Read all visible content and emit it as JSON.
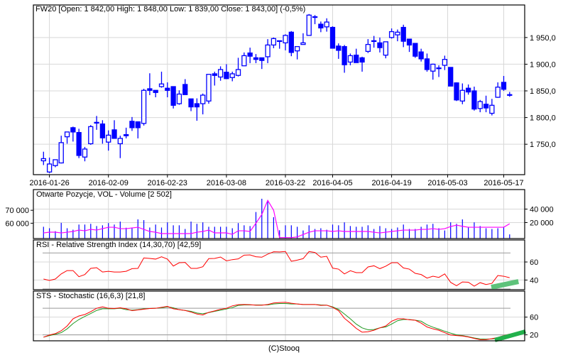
{
  "colors": {
    "candle": "#0000ff",
    "grid": "#d8d8d8",
    "ref_line": "#999999",
    "open_interest": "#ff00ff",
    "volume": "#0000ff",
    "rsi": "#ff0000",
    "sts_k": "#ff0000",
    "sts_d": "#229922",
    "band_rsi": "#5ec27a",
    "band_sts": "#22b14c"
  },
  "footer": "(C)Stooq",
  "chart_data": [
    {
      "type": "candlestick",
      "title": "FW20 [Open: 1 842,00  High: 1 848,00  Low: 1 839,00  Close: 1 843,00] (-0,5%)",
      "ylim": [
        1693,
        2011
      ],
      "y_ticks": [
        1950,
        1900,
        1850,
        1800,
        1750
      ],
      "y_tick_labels": [
        "1 950,0",
        "1 900,0",
        "1 850,0",
        "1 800,0",
        "1 750,0"
      ],
      "x_ticks": [
        {
          "label": "2016-01-26",
          "at_index": 1
        },
        {
          "label": "2016-02-09",
          "at_index": 11
        },
        {
          "label": "2016-02-23",
          "at_index": 21
        },
        {
          "label": "2016-03-08",
          "at_index": 31
        },
        {
          "label": "2016-03-22",
          "at_index": 41
        },
        {
          "label": "2016-04-05",
          "at_index": 49
        },
        {
          "label": "2016-04-19",
          "at_index": 59
        },
        {
          "label": "2016-05-03",
          "at_index": 68.5
        },
        {
          "label": "2016-05-17",
          "at_index": 78
        }
      ],
      "ohlc": [
        [
          1719,
          1736,
          1711,
          1723
        ],
        [
          1698,
          1725,
          1696,
          1713
        ],
        [
          1710,
          1721,
          1707,
          1721
        ],
        [
          1715,
          1766,
          1714,
          1753
        ],
        [
          1764,
          1773,
          1751,
          1773
        ],
        [
          1781,
          1783,
          1755,
          1773
        ],
        [
          1772,
          1779,
          1724,
          1729
        ],
        [
          1726,
          1745,
          1718,
          1741
        ],
        [
          1751,
          1786,
          1749,
          1783
        ],
        [
          1790,
          1803,
          1777,
          1791
        ],
        [
          1788,
          1795,
          1751,
          1762
        ],
        [
          1754,
          1776,
          1738,
          1767
        ],
        [
          1777,
          1795,
          1761,
          1761
        ],
        [
          1751,
          1766,
          1724,
          1761
        ],
        [
          1768,
          1781,
          1761,
          1766
        ],
        [
          1793,
          1801,
          1775,
          1781
        ],
        [
          1792,
          1793,
          1761,
          1781
        ],
        [
          1789,
          1854,
          1785,
          1851
        ],
        [
          1854,
          1883,
          1842,
          1851
        ],
        [
          1851,
          1851,
          1838,
          1847
        ],
        [
          1858,
          1886,
          1856,
          1863
        ],
        [
          1855,
          1866,
          1838,
          1851
        ],
        [
          1858,
          1858,
          1817,
          1823
        ],
        [
          1826,
          1851,
          1824,
          1844
        ],
        [
          1862,
          1872,
          1843,
          1843
        ],
        [
          1835,
          1835,
          1812,
          1820
        ],
        [
          1826,
          1836,
          1794,
          1820
        ],
        [
          1826,
          1845,
          1806,
          1842
        ],
        [
          1831,
          1881,
          1826,
          1881
        ],
        [
          1882,
          1886,
          1860,
          1879
        ],
        [
          1876,
          1896,
          1869,
          1890
        ],
        [
          1885,
          1900,
          1872,
          1873
        ],
        [
          1875,
          1886,
          1868,
          1882
        ],
        [
          1879,
          1912,
          1877,
          1890
        ],
        [
          1897,
          1922,
          1897,
          1916
        ],
        [
          1921,
          1931,
          1902,
          1915
        ],
        [
          1912,
          1919,
          1902,
          1909
        ],
        [
          1912,
          1912,
          1891,
          1907
        ],
        [
          1914,
          1947,
          1902,
          1936
        ],
        [
          1936,
          1950,
          1930,
          1948
        ],
        [
          1943,
          1944,
          1929,
          1944
        ],
        [
          1940,
          1956,
          1926,
          1954
        ],
        [
          1960,
          1962,
          1915,
          1922
        ],
        [
          1925,
          1933,
          1909,
          1933
        ],
        [
          1937,
          1958,
          1937,
          1940
        ],
        [
          1954,
          1994,
          1954,
          1992
        ],
        [
          1989,
          1992,
          1975,
          1988
        ],
        [
          1975,
          1980,
          1960,
          1968
        ],
        [
          1970,
          1986,
          1961,
          1979
        ],
        [
          1969,
          1971,
          1930,
          1930
        ],
        [
          1934,
          1939,
          1910,
          1926
        ],
        [
          1933,
          1936,
          1884,
          1899
        ],
        [
          1904,
          1920,
          1898,
          1916
        ],
        [
          1917,
          1929,
          1903,
          1903
        ],
        [
          1912,
          1914,
          1886,
          1904
        ],
        [
          1924,
          1947,
          1921,
          1937
        ],
        [
          1943,
          1953,
          1931,
          1944
        ],
        [
          1940,
          1950,
          1922,
          1931
        ],
        [
          1917,
          1942,
          1911,
          1942
        ],
        [
          1950,
          1967,
          1948,
          1961
        ],
        [
          1955,
          1965,
          1943,
          1960
        ],
        [
          1969,
          1974,
          1932,
          1943
        ],
        [
          1947,
          1947,
          1923,
          1936
        ],
        [
          1939,
          1939,
          1912,
          1915
        ],
        [
          1923,
          1929,
          1905,
          1910
        ],
        [
          1910,
          1920,
          1886,
          1890
        ],
        [
          1887,
          1901,
          1871,
          1900
        ],
        [
          1893,
          1898,
          1876,
          1893
        ],
        [
          1898,
          1916,
          1889,
          1909
        ],
        [
          1894,
          1894,
          1859,
          1859
        ],
        [
          1865,
          1866,
          1831,
          1833
        ],
        [
          1831,
          1864,
          1825,
          1851
        ],
        [
          1855,
          1862,
          1843,
          1848
        ],
        [
          1850,
          1858,
          1813,
          1816
        ],
        [
          1817,
          1833,
          1810,
          1830
        ],
        [
          1825,
          1841,
          1810,
          1818
        ],
        [
          1808,
          1835,
          1804,
          1823
        ],
        [
          1838,
          1866,
          1837,
          1857
        ],
        [
          1866,
          1878,
          1850,
          1853
        ],
        [
          1842,
          1848,
          1839,
          1843
        ]
      ]
    },
    {
      "type": "bar+line",
      "title": "Otwarte Pozycje, VOL - Volume [2 502]",
      "left_axis": {
        "name": "open interest",
        "ylim": [
          48140,
          86000
        ],
        "ticks": [
          70000,
          60000
        ],
        "tick_labels": [
          "70 000",
          "60 000"
        ]
      },
      "right_axis": {
        "name": "volume",
        "ylim": [
          -3700,
          68900
        ],
        "ticks": [
          40000,
          20000
        ],
        "tick_labels": [
          "40 000",
          "20 000"
        ]
      },
      "volume": [
        13770,
        11580,
        7210,
        19560,
        11580,
        9400,
        17050,
        17050,
        18140,
        14860,
        15950,
        19230,
        17050,
        21420,
        12350,
        12680,
        24700,
        23610,
        12680,
        17050,
        12680,
        20330,
        15950,
        15950,
        10490,
        21420,
        18140,
        20330,
        13770,
        13770,
        13770,
        13770,
        11580,
        19230,
        15950,
        14860,
        35630,
        55300,
        50930,
        27980,
        8680,
        15950,
        15950,
        13770,
        8310,
        15950,
        10490,
        11580,
        9400,
        17050,
        15950,
        20330,
        14860,
        13770,
        13770,
        15950,
        10490,
        14860,
        11580,
        10490,
        12680,
        17050,
        10490,
        10490,
        13770,
        17050,
        18140,
        11580,
        8310,
        20330,
        18140,
        24700,
        12680,
        20330,
        14860,
        11580,
        10490,
        11580,
        13770,
        2502
      ],
      "open_interest": [
        52510,
        53060,
        53060,
        52510,
        53060,
        53610,
        54700,
        54150,
        55250,
        54700,
        55790,
        56890,
        56890,
        55790,
        55790,
        56340,
        56890,
        55250,
        53610,
        53060,
        51970,
        51970,
        51970,
        51970,
        51970,
        51970,
        53060,
        53610,
        54700,
        52510,
        52510,
        52510,
        51420,
        54150,
        54150,
        53610,
        60000,
        66720,
        77650,
        70000,
        48850,
        48850,
        48850,
        49400,
        51240,
        53060,
        54150,
        54150,
        54150,
        53610,
        54150,
        53610,
        53610,
        53610,
        53610,
        53610,
        53060,
        52510,
        53060,
        53610,
        54150,
        54700,
        54700,
        54700,
        55250,
        55250,
        55790,
        55250,
        55790,
        57430,
        58520,
        57620,
        56890,
        56890,
        56890,
        56890,
        56890,
        56890,
        56890,
        59620
      ]
    },
    {
      "type": "line",
      "title": "RSI - Relative Strength Index (14,30,70) [42,59]",
      "ylim": [
        29.3,
        84.4
      ],
      "ticks": [
        60,
        40
      ],
      "tick_labels": [
        "60",
        "40"
      ],
      "ref_lines": [
        30,
        70
      ],
      "values": [
        41.1,
        39.5,
        41.1,
        46.8,
        50.5,
        50.5,
        43.7,
        46.1,
        52.9,
        53.7,
        48.9,
        49.7,
        48.9,
        48.9,
        49.7,
        52.6,
        52.9,
        64.5,
        63.9,
        63.2,
        65.8,
        63.2,
        55.5,
        59.2,
        59.5,
        52.9,
        52.9,
        54.7,
        63.7,
        63.9,
        65.5,
        61.3,
        62.6,
        63.4,
        67.6,
        67.9,
        65.8,
        65.3,
        68.7,
        71.3,
        71.1,
        71.6,
        60.8,
        62.1,
        63.7,
        71.6,
        70.5,
        65.3,
        66.3,
        53.2,
        52.1,
        46.8,
        50.3,
        48.2,
        48.2,
        54.5,
        55.8,
        52.6,
        55.3,
        59.2,
        59.2,
        53.4,
        52.1,
        47.4,
        46.1,
        42.1,
        44.2,
        42.9,
        46.8,
        37.4,
        33.7,
        37.9,
        37.6,
        33.2,
        37.1,
        35,
        36.3,
        45,
        44.2,
        42.59
      ],
      "band": {
        "from": [
          75.9,
          32
        ],
        "to": [
          80.5,
          38.3
        ]
      }
    },
    {
      "type": "line",
      "title": "STS - Stochastic (16,6,3) [21,8]",
      "ylim": [
        6.5,
        118.8
      ],
      "ticks": [
        60,
        20
      ],
      "tick_labels": [
        "60",
        "20"
      ],
      "ref_lines": [
        20,
        80
      ],
      "series": [
        {
          "name": "%K",
          "values": [
            14.6,
            19.5,
            22.7,
            29.2,
            40,
            56.2,
            62.7,
            65.9,
            72.4,
            80,
            83.2,
            80,
            79.5,
            81.1,
            78.9,
            74.6,
            76.2,
            77.8,
            79.5,
            80,
            82.2,
            84.3,
            78.9,
            76.8,
            75.1,
            71.4,
            67,
            64.9,
            70.8,
            74.1,
            77.8,
            80,
            85.4,
            88.1,
            88.6,
            88.1,
            87,
            87,
            88.6,
            91.9,
            93,
            93.5,
            91.4,
            89.7,
            88.6,
            88.6,
            88.6,
            86.5,
            87,
            82.2,
            74.6,
            57.3,
            46.5,
            34.6,
            25.9,
            27,
            30.3,
            35.7,
            40,
            50.8,
            56.2,
            56.2,
            54.1,
            53,
            46.5,
            37.8,
            33.5,
            30.3,
            24.9,
            19.5,
            18.4,
            17.3,
            15.1,
            11.9,
            9.2,
            9.2,
            11.4,
            14.1,
            18.4,
            21.8
          ]
        },
        {
          "name": "%D",
          "values": [
            14.6,
            18.4,
            21.1,
            24.9,
            33.5,
            45.4,
            54.6,
            61.6,
            68.1,
            75.1,
            78.9,
            78.9,
            78.9,
            80,
            76.8,
            75.7,
            76.8,
            78.9,
            79.5,
            80,
            81.1,
            83.2,
            81.1,
            76.8,
            75.1,
            73,
            69.2,
            67.6,
            70.3,
            73,
            75.7,
            78.4,
            81.6,
            86.5,
            87.6,
            87.6,
            87.6,
            87.6,
            87.6,
            89.7,
            90.8,
            90.8,
            89.7,
            89.7,
            88.6,
            88.6,
            88.6,
            87.6,
            87,
            83.2,
            77.3,
            67,
            56.2,
            44.3,
            35.7,
            31.4,
            31.9,
            35.7,
            37.8,
            44.3,
            51.9,
            54.6,
            54.6,
            53,
            50.8,
            42.7,
            37.3,
            33,
            28.1,
            23.8,
            20,
            18.4,
            15.7,
            13,
            10.8,
            10.3,
            10.8,
            11.9,
            14.6,
            17.3
          ]
        }
      ],
      "band": {
        "from": [
          76.5,
          8.2
        ],
        "to": [
          81.7,
          27.6
        ]
      }
    }
  ]
}
